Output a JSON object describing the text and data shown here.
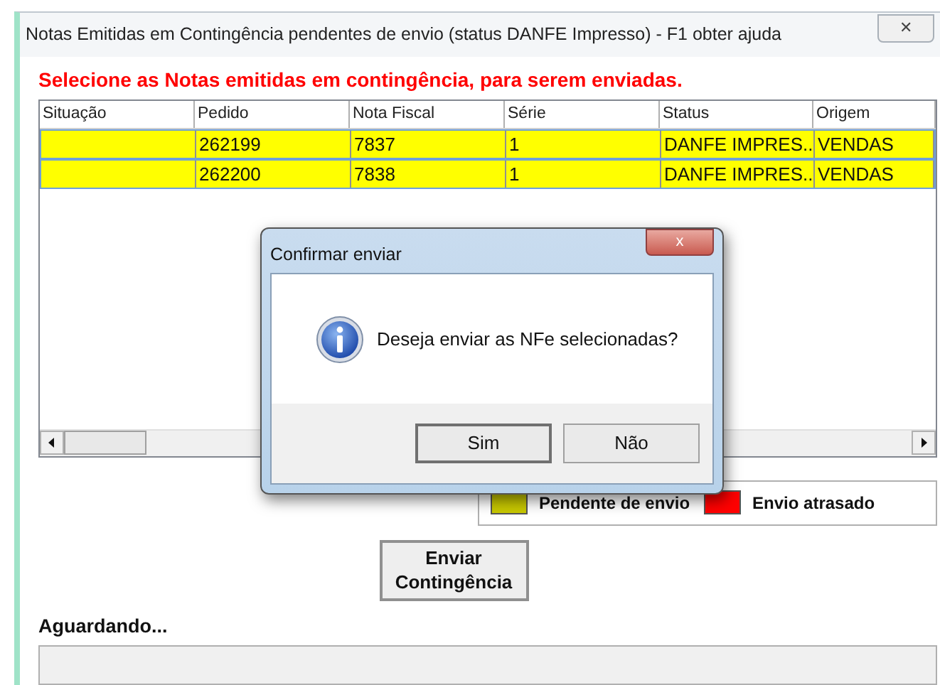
{
  "window": {
    "title": "Notas Emitidas em Contingência pendentes de envio (status DANFE Impresso) - F1 obter ajuda",
    "close": "✕"
  },
  "instruction": "Selecione as Notas emitidas em contingência, para serem enviadas.",
  "table": {
    "columns": [
      "Situação",
      "Pedido",
      "Nota Fiscal",
      "Série",
      "Status",
      "Origem"
    ],
    "rows": [
      {
        "color": "#ffff00",
        "cells": [
          "",
          "262199",
          "7837",
          "1",
          "DANFE IMPRES...",
          "VENDAS"
        ]
      },
      {
        "color": "#ffff00",
        "cells": [
          "",
          "262200",
          "7838",
          "1",
          "DANFE IMPRES...",
          "VENDAS"
        ]
      }
    ]
  },
  "legend": [
    {
      "label": "Pendente de envio",
      "color": "#c8c800"
    },
    {
      "label": "Envio atrasado",
      "color": "#ff0000"
    }
  ],
  "send_button": "Enviar Contingência",
  "status_label": "Aguardando...",
  "dialog": {
    "title": "Confirmar enviar",
    "close": "x",
    "message": "Deseja enviar as NFe selecionadas?",
    "buttons": [
      "Sim",
      "Não"
    ]
  }
}
